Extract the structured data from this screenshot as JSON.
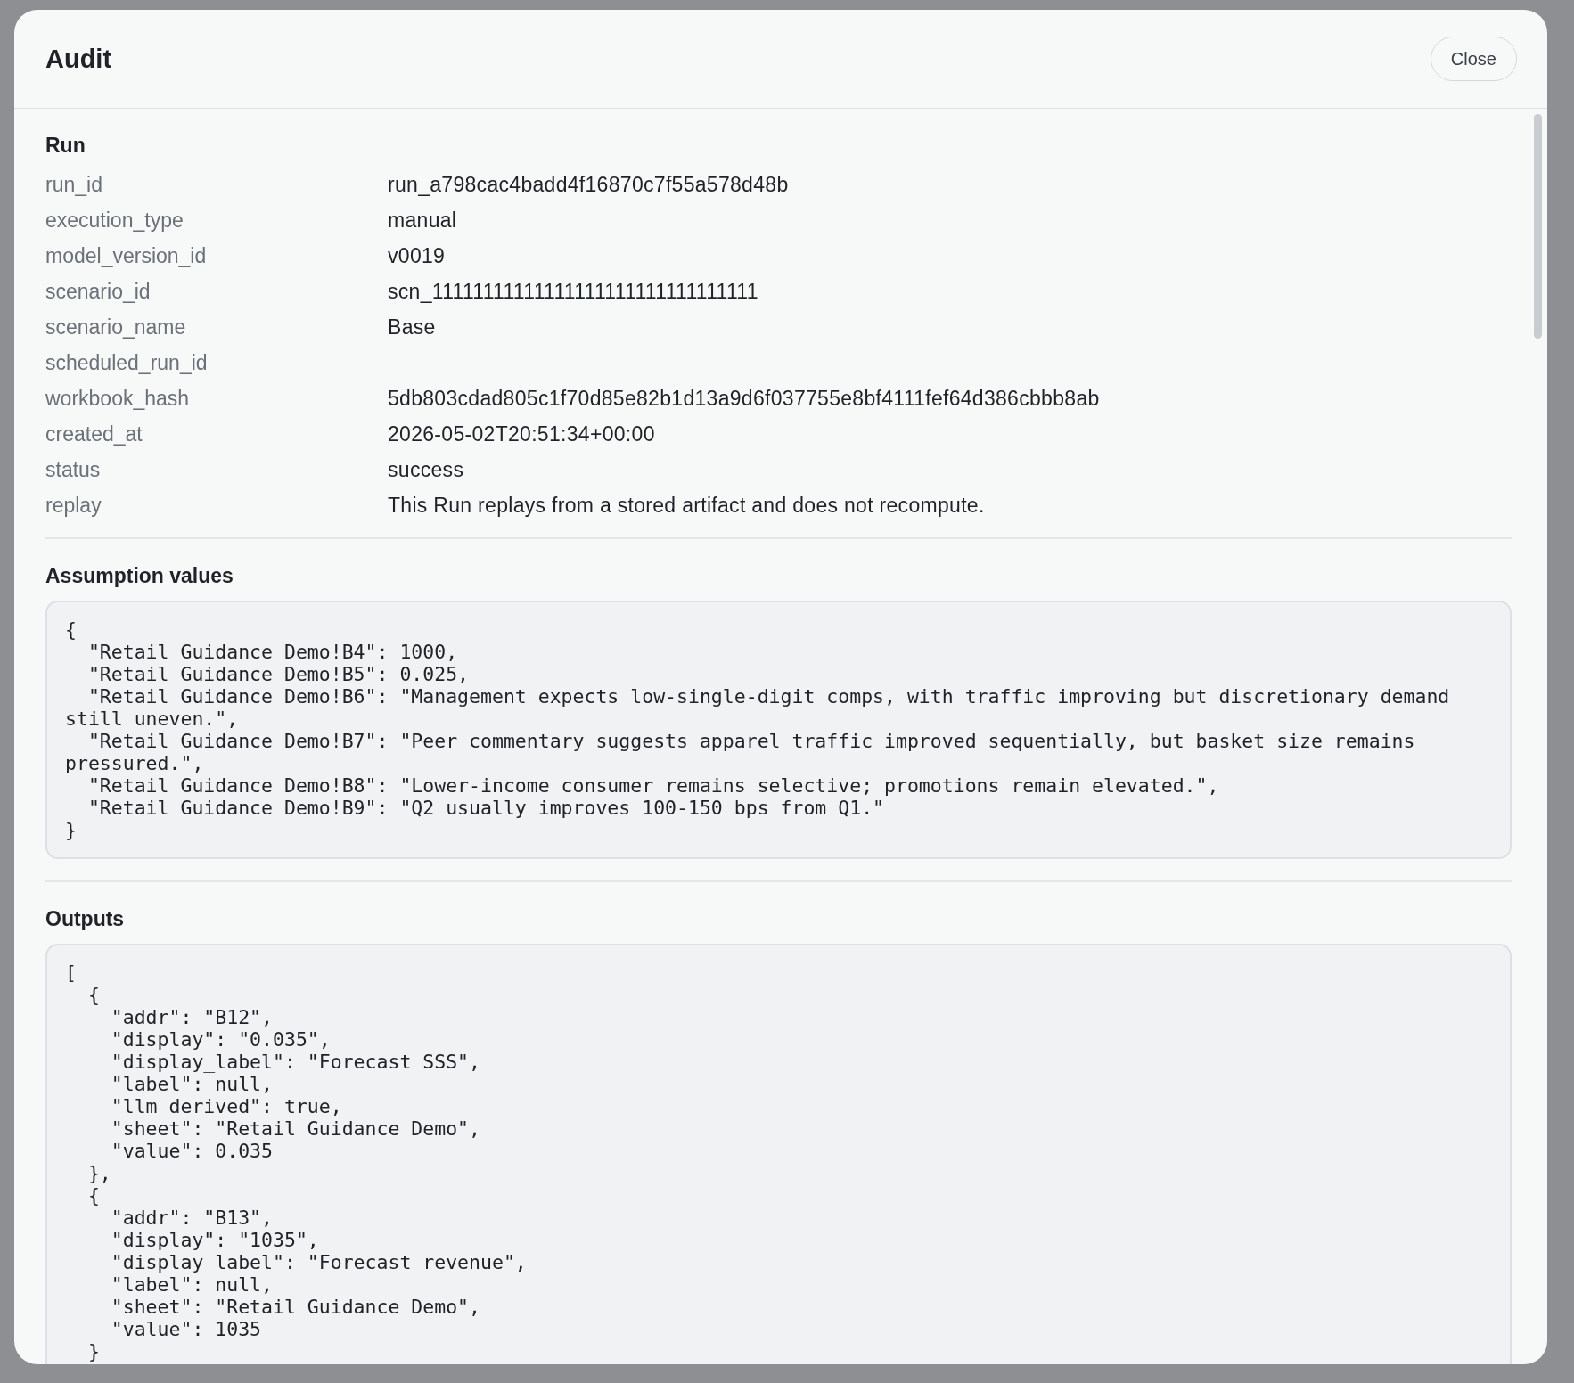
{
  "dialog": {
    "title": "Audit",
    "close_button": "Close"
  },
  "run": {
    "heading": "Run",
    "fields": [
      {
        "label": "run_id",
        "value": "run_a798cac4badd4f16870c7f55a578d48b"
      },
      {
        "label": "execution_type",
        "value": "manual"
      },
      {
        "label": "model_version_id",
        "value": "v0019"
      },
      {
        "label": "scenario_id",
        "value": "scn_11111111111111111111111111111111"
      },
      {
        "label": "scenario_name",
        "value": "Base"
      },
      {
        "label": "scheduled_run_id"
      },
      {
        "label": "workbook_hash",
        "value": "5db803cdad805c1f70d85e82b1d13a9d6f037755e8bf4111fef64d386cbbb8ab"
      },
      {
        "label": "created_at",
        "value": "2026-05-02T20:51:34+00:00"
      },
      {
        "label": "status",
        "value": "success"
      },
      {
        "label": "replay",
        "value": "This Run replays from a stored artifact and does not recompute."
      }
    ]
  },
  "assumptions": {
    "heading": "Assumption values",
    "code": "{\n  \"Retail Guidance Demo!B4\": 1000,\n  \"Retail Guidance Demo!B5\": 0.025,\n  \"Retail Guidance Demo!B6\": \"Management expects low-single-digit comps, with traffic improving but discretionary demand still uneven.\",\n  \"Retail Guidance Demo!B7\": \"Peer commentary suggests apparel traffic improved sequentially, but basket size remains pressured.\",\n  \"Retail Guidance Demo!B8\": \"Lower-income consumer remains selective; promotions remain elevated.\",\n  \"Retail Guidance Demo!B9\": \"Q2 usually improves 100-150 bps from Q1.\"\n}"
  },
  "outputs": {
    "heading": "Outputs",
    "code": "[\n  {\n    \"addr\": \"B12\",\n    \"display\": \"0.035\",\n    \"display_label\": \"Forecast SSS\",\n    \"label\": null,\n    \"llm_derived\": true,\n    \"sheet\": \"Retail Guidance Demo\",\n    \"value\": 0.035\n  },\n  {\n    \"addr\": \"B13\",\n    \"display\": \"1035\",\n    \"display_label\": \"Forecast revenue\",\n    \"label\": null,\n    \"sheet\": \"Retail Guidance Demo\",\n    \"value\": 1035\n  }"
  }
}
